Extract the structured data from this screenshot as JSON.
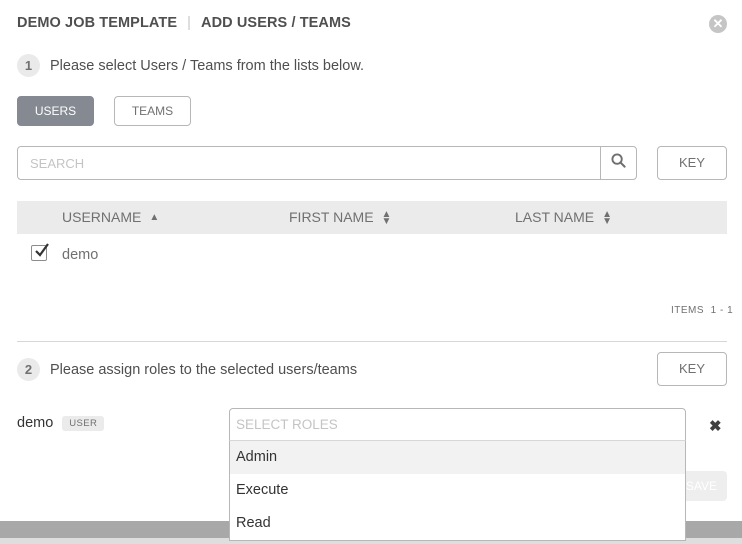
{
  "header": {
    "resource_title": "DEMO JOB TEMPLATE",
    "separator": "|",
    "dialog_title": "ADD USERS / TEAMS",
    "close_icon": "close-circle-icon"
  },
  "step1": {
    "number": "1",
    "instruction": "Please select Users / Teams from the lists below."
  },
  "tabs": [
    {
      "label": "USERS",
      "active": true
    },
    {
      "label": "TEAMS",
      "active": false
    }
  ],
  "search": {
    "placeholder": "SEARCH",
    "value": "",
    "icon": "search-icon",
    "key_label": "KEY"
  },
  "table": {
    "columns": [
      {
        "label": "USERNAME",
        "sort": "ascending"
      },
      {
        "label": "FIRST NAME",
        "sort": "sortable"
      },
      {
        "label": "LAST NAME",
        "sort": "sortable"
      }
    ],
    "rows": [
      {
        "selected": true,
        "username": "demo",
        "first_name": "",
        "last_name": ""
      }
    ],
    "items_label": "ITEMS",
    "items_range": "1 - 1"
  },
  "step2": {
    "number": "2",
    "instruction": "Please assign roles to the selected users/teams",
    "key_label": "KEY"
  },
  "assignment": {
    "name": "demo",
    "type_badge": "USER",
    "roles_placeholder": "SELECT ROLES",
    "remove_icon": "close-icon"
  },
  "roles_dropdown": {
    "options": [
      "Admin",
      "Execute",
      "Read"
    ],
    "highlighted": "Admin"
  },
  "save_label": "SAVE"
}
